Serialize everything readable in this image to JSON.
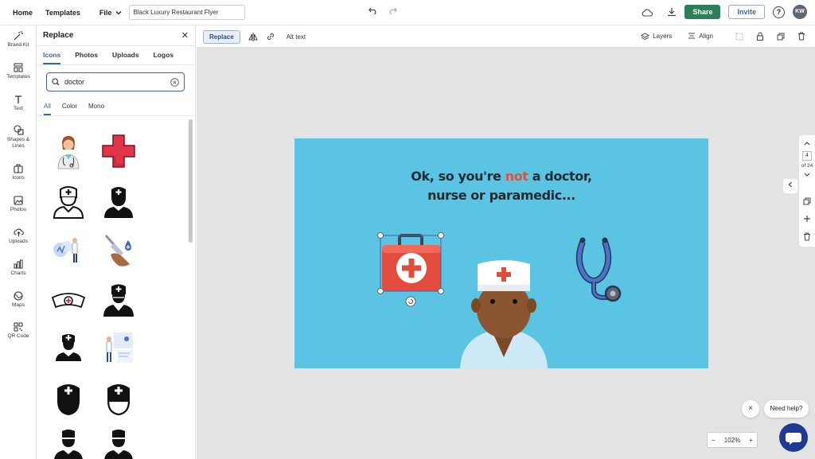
{
  "topbar": {
    "home": "Home",
    "templates": "Templates",
    "file": "File",
    "doc_name": "Black Luxury Restaurant Flyer",
    "share": "Share",
    "invite": "Invite",
    "help": "?",
    "avatar_initials": "KW"
  },
  "rail": {
    "items": [
      {
        "label": "Brand Kit",
        "icon": "magic-wand-icon"
      },
      {
        "label": "Templates",
        "icon": "templates-icon"
      },
      {
        "label": "Text",
        "icon": "text-icon"
      },
      {
        "label": "Shapes & Lines",
        "icon": "shapes-icon"
      },
      {
        "label": "Icons",
        "icon": "icons-icon"
      },
      {
        "label": "Photos",
        "icon": "photos-icon"
      },
      {
        "label": "Uploads",
        "icon": "upload-icon"
      },
      {
        "label": "Charts",
        "icon": "chart-icon"
      },
      {
        "label": "Maps",
        "icon": "map-icon"
      },
      {
        "label": "QR Code",
        "icon": "qr-code-icon"
      }
    ]
  },
  "panel": {
    "title": "Replace",
    "tabs": [
      "Icons",
      "Photos",
      "Uploads",
      "Logos"
    ],
    "active_tab": "Icons",
    "search_value": "doctor",
    "filters": [
      "All",
      "Color",
      "Mono"
    ],
    "active_filter": "All"
  },
  "toolbar2": {
    "replace": "Replace",
    "alt_text": "Alt text",
    "layers": "Layers",
    "align": "Align"
  },
  "slide": {
    "line1_pre": "Ok, so you're ",
    "line1_highlight": "not",
    "line1_post": " a doctor,",
    "line2": "nurse or paramedic...",
    "background": "#5bc4e3",
    "highlight_color": "#d9543f"
  },
  "page_nav": {
    "current": "4",
    "total": "of 24"
  },
  "zoom": {
    "minus": "−",
    "value": "102%",
    "plus": "+"
  },
  "help": {
    "need_help": "Need help?",
    "close": "×"
  },
  "colors": {
    "accent": "#3d63b8",
    "share": "#2e7d5b"
  }
}
